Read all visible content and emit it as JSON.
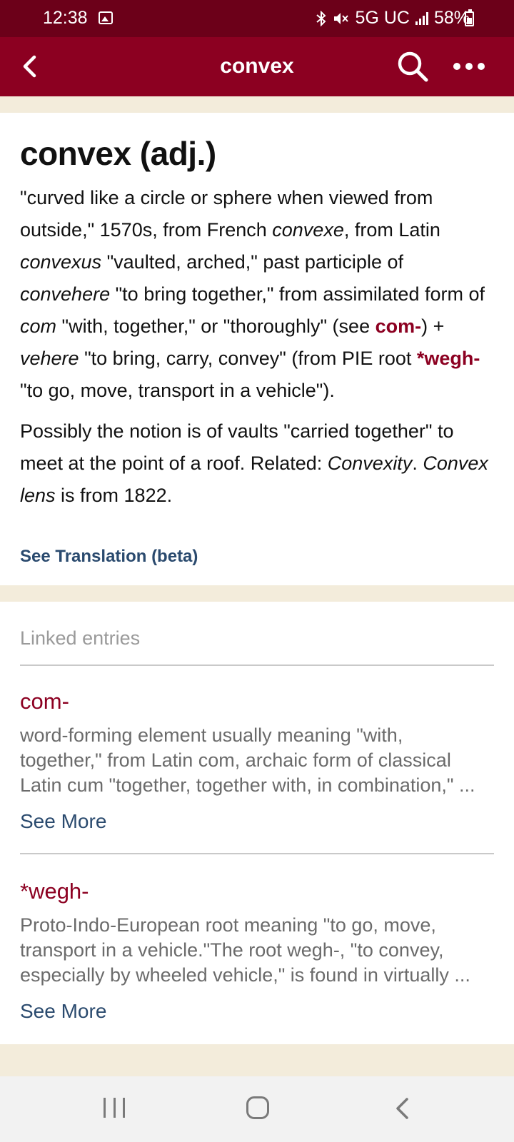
{
  "status_bar": {
    "time": "12:38",
    "network": "5G UC",
    "battery": "58%",
    "battery_level": 0.58,
    "icons": [
      "gallery-icon",
      "bluetooth-icon",
      "mute-icon",
      "signal-icon",
      "battery-icon"
    ]
  },
  "app_bar": {
    "title": "convex",
    "icons": [
      "back-arrow-icon",
      "search-icon",
      "more-options-icon"
    ]
  },
  "entry": {
    "headword": "convex (adj.)",
    "paragraph1": {
      "t1": "\"curved like a circle or sphere when viewed from outside,\" 1570s, from French ",
      "i1": "convexe",
      "t2": ", from Latin ",
      "i2": "convexus",
      "t3": " \"vaulted, arched,\" past participle of ",
      "i3": "convehere",
      "t4": " \"to bring together,\" from assimilated form of ",
      "i4": "com",
      "t5": " \"with, together,\" or \"thoroughly\" (see ",
      "link1": "com-",
      "t6": ") + ",
      "i5": "vehere",
      "t7": " \"to bring, carry, convey\" (from PIE root ",
      "link2": "*wegh-",
      "t8": " \"to go, move, transport in a vehicle\")."
    },
    "paragraph2": {
      "t1": "Possibly the notion is of vaults \"carried together\" to meet at the point of a roof. Related: ",
      "i1": "Convexity",
      "t2": ". ",
      "i2": "Convex lens",
      "t3": " is from 1822."
    },
    "translation_link": "See Translation (beta)"
  },
  "linked": {
    "label": "Linked entries",
    "items": [
      {
        "title": "com-",
        "lines": [
          "word-forming element usually meaning \"with,",
          "together,\" from Latin com, archaic form of classical",
          "Latin cum \"together, together with, in combination,\" ..."
        ],
        "see_more": "See More"
      },
      {
        "title": "*wegh-",
        "lines": [
          "Proto-Indo-European root meaning \"to go, move,",
          "transport in a vehicle.\"The root wegh-, \"to convey,",
          "especially by wheeled vehicle,\" is found in virtually ..."
        ],
        "see_more": "See More"
      }
    ]
  },
  "colors": {
    "status_bar": "#6c0019",
    "app_bar": "#8c0021",
    "accent_link": "#8c0021",
    "secondary_link": "#2a4a6e",
    "page_background": "#f3ecdb"
  }
}
